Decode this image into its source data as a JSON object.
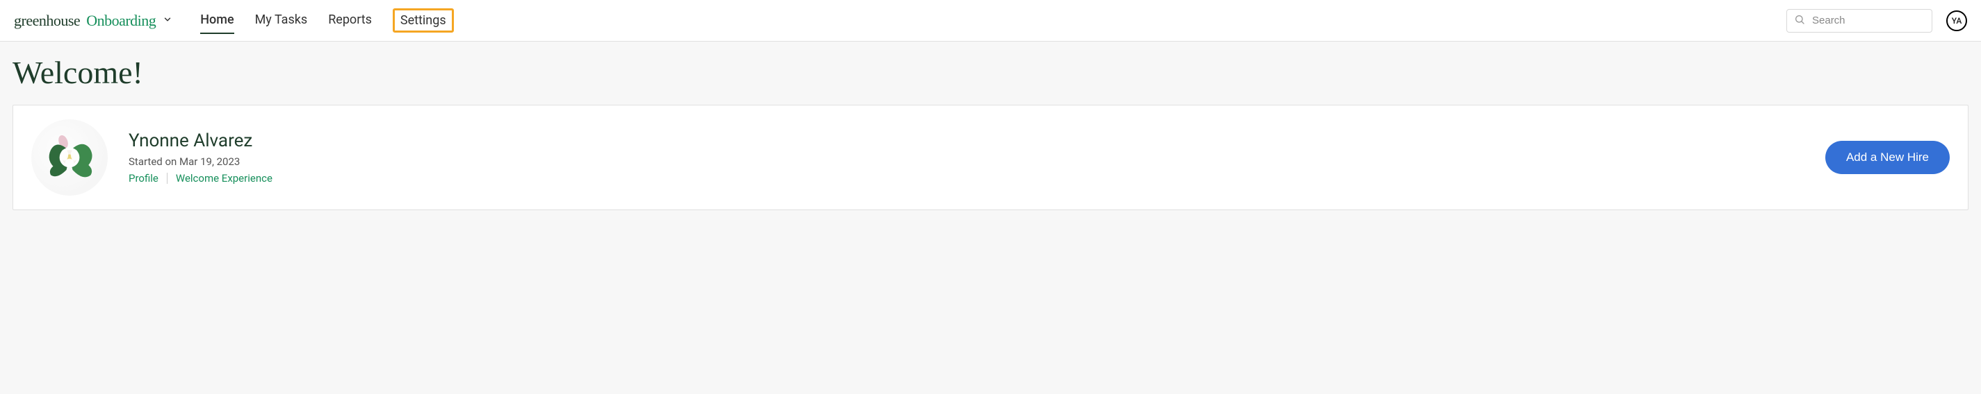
{
  "header": {
    "logo": {
      "greenhouse": "greenhouse",
      "onboarding": "Onboarding"
    },
    "nav": [
      {
        "label": "Home",
        "active": true,
        "highlighted": false
      },
      {
        "label": "My Tasks",
        "active": false,
        "highlighted": false
      },
      {
        "label": "Reports",
        "active": false,
        "highlighted": false
      },
      {
        "label": "Settings",
        "active": false,
        "highlighted": true
      }
    ],
    "search": {
      "placeholder": "Search"
    },
    "user_initials": "YA"
  },
  "page": {
    "title": "Welcome!"
  },
  "hire": {
    "name": "Ynonne Alvarez",
    "started_text": "Started on Mar 19, 2023",
    "links": {
      "profile": "Profile",
      "welcome_experience": "Welcome Experience"
    },
    "add_button_label": "Add a New Hire"
  }
}
